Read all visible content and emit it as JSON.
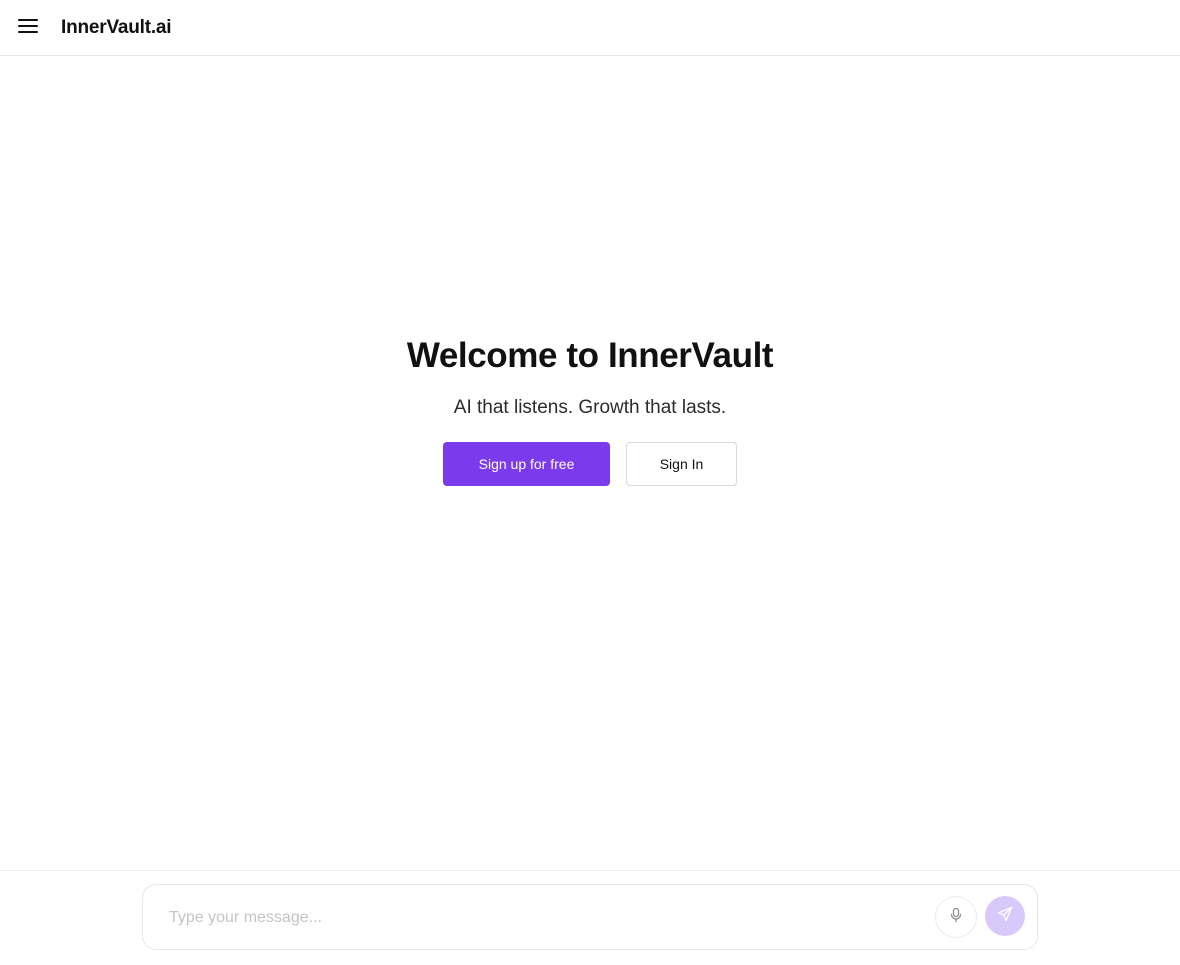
{
  "header": {
    "brand": "InnerVault.ai",
    "menu_icon": "hamburger-menu-icon"
  },
  "hero": {
    "title": "Welcome to InnerVault",
    "subtitle": "AI that listens. Growth that lasts.",
    "primary_button": "Sign up for free",
    "secondary_button": "Sign In"
  },
  "composer": {
    "placeholder": "Type your message...",
    "value": "",
    "mic_icon": "microphone-icon",
    "send_icon": "send-icon"
  },
  "colors": {
    "accent": "#7c3aed",
    "send_button_disabled": "#d9c9fb"
  }
}
